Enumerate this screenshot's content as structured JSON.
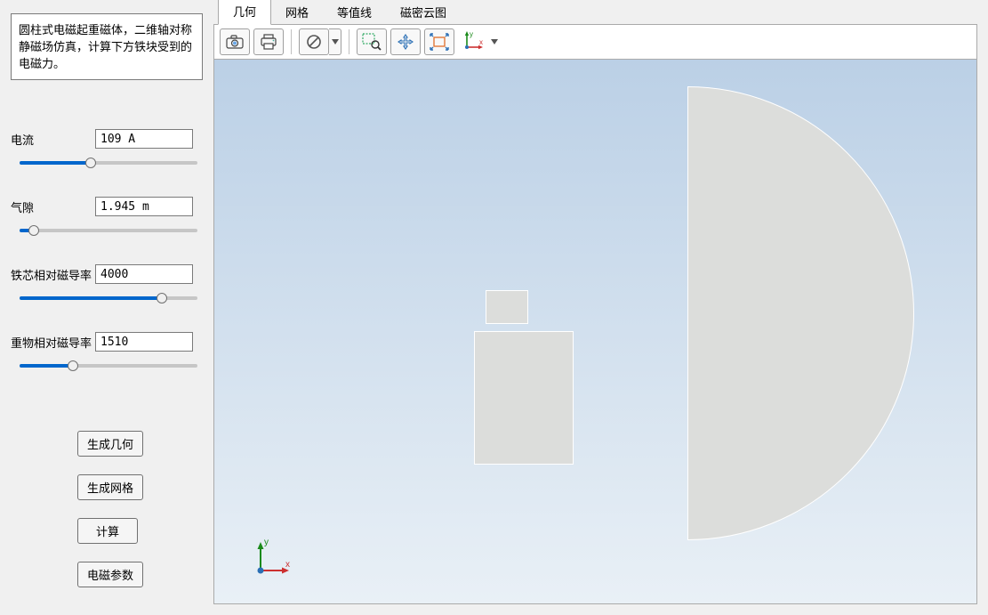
{
  "description": "圆柱式电磁起重磁体，二维轴对称静磁场仿真，计算下方铁块受到的电磁力。",
  "params": {
    "current": {
      "label": "电流",
      "value": "109 A",
      "percent": 40
    },
    "gap": {
      "label": "气隙",
      "value": "1.945 m",
      "percent": 8
    },
    "core_mu": {
      "label": "铁芯相对磁导率",
      "value": "4000",
      "percent": 80
    },
    "load_mu": {
      "label": "重物相对磁导率",
      "value": "1510",
      "percent": 30
    }
  },
  "buttons": {
    "geom": "生成几何",
    "mesh": "生成网格",
    "solve": "计算",
    "params": "电磁参数"
  },
  "tabs": {
    "geom": "几何",
    "mesh": "网格",
    "iso": "等值线",
    "cloud": "磁密云图"
  },
  "triad": {
    "xlabel": "x",
    "ylabel": "y"
  },
  "icons": {
    "camera": "camera-icon",
    "print": "print-icon",
    "forbid": "forbid-icon",
    "zoombox": "zoom-box-icon",
    "pan": "pan-icon",
    "extent": "zoom-extents-icon",
    "axes": "axes-mini-icon"
  }
}
